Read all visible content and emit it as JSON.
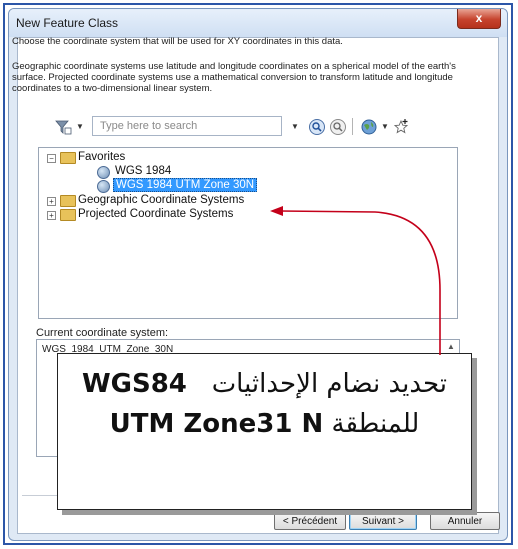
{
  "window": {
    "title": "New Feature Class",
    "close_glyph": "x"
  },
  "description": {
    "intro": "Choose the coordinate system that will be used for XY coordinates in this data.",
    "detail": "Geographic coordinate systems use latitude and longitude coordinates on a spherical model of the earth's surface. Projected coordinate systems use a mathematical conversion to transform latitude and longitude coordinates to a two-dimensional linear system."
  },
  "toolbar": {
    "search_placeholder": "Type here to search",
    "icons": [
      "filter-icon",
      "search-icon",
      "clear-search-icon",
      "globe-icon",
      "add-favorite-icon"
    ]
  },
  "tree": {
    "favorites": "Favorites",
    "items": [
      "WGS 1984",
      "WGS 1984 UTM Zone 30N"
    ],
    "geographic": "Geographic Coordinate Systems",
    "projected": "Projected Coordinate Systems",
    "expand_minus": "−",
    "expand_plus": "+"
  },
  "current": {
    "label": "Current coordinate system:",
    "value": "WGS_1984_UTM_Zone_30N"
  },
  "buttons": {
    "back": "< Précédent",
    "next": "Suivant >",
    "cancel": "Annuler"
  },
  "callout": {
    "line1_ar": "تحديد نضام الإحداثيات",
    "line1_en": "WGS84",
    "line2_en": "UTM Zone31 N",
    "line2_ar": "للمنطقة"
  },
  "colors": {
    "selection": "#3399ff",
    "arrow": "#c4001a",
    "frame": "#2c56a8"
  }
}
